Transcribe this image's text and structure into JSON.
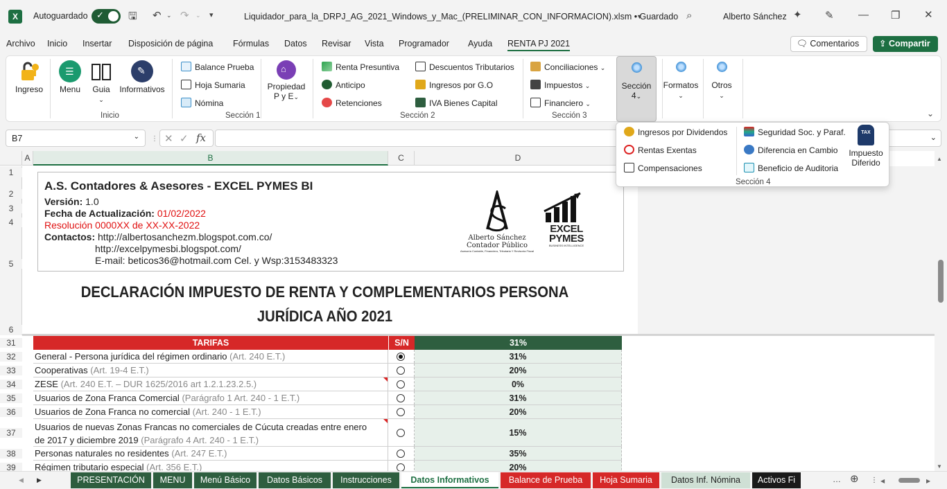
{
  "titlebar": {
    "autosave_label": "Autoguardado",
    "filename": "Liquidador_para_la_DRPJ_AG_2021_Windows_y_Mac_(PRELIMINAR_CON_INFORMACION).xlsm • Guardado",
    "user": "Alberto Sánchez"
  },
  "menu": [
    "Archivo",
    "Inicio",
    "Insertar",
    "Disposición de página",
    "Fórmulas",
    "Datos",
    "Revisar",
    "Vista",
    "Programador",
    "Ayuda",
    "RENTA PJ 2021"
  ],
  "header_buttons": {
    "comments": "Comentarios",
    "share": "Compartir"
  },
  "ribbon": {
    "inicio": {
      "buttons": [
        "Ingreso",
        "Menu",
        "Guia",
        "Informativos"
      ],
      "label": "Inicio"
    },
    "seccion1": {
      "items": [
        "Balance Prueba",
        "Hoja Sumaria",
        "Nómina"
      ],
      "big": "Propiedad",
      "big2": "P y E",
      "label": "Sección 1"
    },
    "seccion2": {
      "col1": [
        "Renta Presuntiva",
        "Anticipo",
        "Retenciones"
      ],
      "col2": [
        "Descuentos Tributarios",
        "Ingresos por G.O",
        "IVA Bienes Capital"
      ],
      "label": "Sección 2"
    },
    "seccion3": {
      "items": [
        "Conciliaciones",
        "Impuestos",
        "Financiero"
      ],
      "label": "Sección 3"
    },
    "seccion4": {
      "label": "Sección",
      "num": "4"
    },
    "formatos": "Formatos",
    "otros": "Otros"
  },
  "popup": {
    "col1": [
      "Ingresos por Dividendos",
      "Rentas Exentas",
      "Compensaciones"
    ],
    "col2": [
      "Seguridad Soc. y Paraf.",
      "Diferencia en Cambio",
      "Beneficio de Auditoria"
    ],
    "big": "Impuesto",
    "big2": "Diferido",
    "label": "Sección 4",
    "tax_icon_text": "TAX"
  },
  "namebox": "B7",
  "fx": "fx",
  "columns": [
    "A",
    "B",
    "C",
    "D"
  ],
  "row_numbers_top": [
    "1",
    "2",
    "3",
    "4",
    "5",
    "6"
  ],
  "company": {
    "name": "A.S. Contadores & Asesores - EXCEL PYMES BI",
    "version_label": "Versión:",
    "version": "1.0",
    "update_label": "Fecha de Actualización:",
    "update": "01/02/2022",
    "resolution": "Resolución 0000XX de XX-XX-2022",
    "contacts_label": "Contactos:",
    "url1": "http://albertosanchezm.blogspot.com.co/",
    "url2": "http://excelpymesbi.blogspot.com/",
    "email": "E-mail: beticos36@hotmail.com  Cel. y Wsp:3153483323",
    "logo_name": "Alberto Sánchez",
    "logo_title": "Contador Público",
    "logo_small": "Asesoría Contable, Financiera, Tributaria Y Revisoría Fiscal",
    "logo2_line1": "EXCEL",
    "logo2_line2": "PYMES",
    "logo2_sub": "BUSINESS INTELLIGENCE"
  },
  "declaration_title": [
    "DECLARACIÓN IMPUESTO DE RENTA Y COMPLEMENTARIOS PERSONA",
    "JURÍDICA AÑO 2021"
  ],
  "table": {
    "header": {
      "col1": "TARIFAS",
      "col2": "S/N",
      "col3": "31%",
      "row": "31"
    },
    "rows": [
      {
        "row": "32",
        "text": "General - Persona jurídica del régimen ordinario",
        "ref": "(Art. 240 E.T.)",
        "val": "31%",
        "selected": true
      },
      {
        "row": "33",
        "text": "Cooperativas",
        "ref": "(Art. 19-4 E.T.)",
        "val": "20%"
      },
      {
        "row": "34",
        "text": "ZESE",
        "ref": "(Art. 240 E.T. – DUR 1625/2016 art 1.2.1.23.2.5.)",
        "val": "0%"
      },
      {
        "row": "35",
        "text": "Usuarios de Zona Franca Comercial",
        "ref": "(Parágrafo 1 Art. 240 - 1 E.T.)",
        "val": "31%"
      },
      {
        "row": "36",
        "text": "Usuarios de Zona Franca no comercial",
        "ref": "(Art. 240 - 1 E.T.)",
        "val": "20%"
      },
      {
        "row": "37",
        "text": "Usuarios de nuevas Zonas Francas no comerciales de Cúcuta creadas entre enero",
        "text2": "de 2017 y diciembre 2019",
        "ref": "(Parágrafo 4 Art. 240 - 1 E.T.)",
        "val": "15%"
      },
      {
        "row": "38",
        "text": "Personas naturales no residentes",
        "ref": "(Art. 247 E.T.)",
        "val": "35%"
      },
      {
        "row": "39",
        "text": "Régimen tributario especial",
        "ref": "(Art. 356 E.T.)",
        "val": "20%"
      }
    ]
  },
  "sheet_tabs": [
    {
      "label": "PRESENTACIÓN",
      "bg": "#2e5e3f",
      "fg": "#ffffff"
    },
    {
      "label": "MENU",
      "bg": "#2e5e3f",
      "fg": "#ffffff"
    },
    {
      "label": "Menú Básico",
      "bg": "#2e5e3f",
      "fg": "#ffffff"
    },
    {
      "label": "Datos Básicos",
      "bg": "#2e5e3f",
      "fg": "#ffffff"
    },
    {
      "label": "Instrucciones",
      "bg": "#2e5e3f",
      "fg": "#ffffff"
    },
    {
      "label": "Datos Informativos",
      "bg": "#ffffff",
      "fg": "#1d6f42"
    },
    {
      "label": "Balance de Prueba",
      "bg": "#d62828",
      "fg": "#ffffff"
    },
    {
      "label": "Hoja Sumaria",
      "bg": "#d62828",
      "fg": "#ffffff"
    },
    {
      "label": "Datos Inf. Nómina",
      "bg": "#cfe0d5",
      "fg": "#222222"
    },
    {
      "label": "Activos Fi",
      "bg": "#1a1a1a",
      "fg": "#ffffff"
    }
  ],
  "colors": {
    "accent": "#1d6f42",
    "table_header_red": "#d62828",
    "table_header_green": "#2e5e3f"
  }
}
